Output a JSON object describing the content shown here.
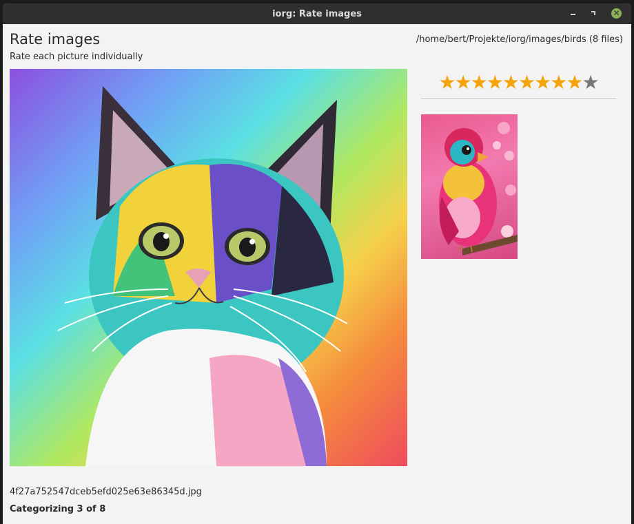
{
  "window": {
    "title": "iorg: Rate images",
    "controls": [
      "minimize-icon",
      "maximize-icon",
      "close-icon"
    ]
  },
  "header": {
    "heading": "Rate images",
    "subtitle": "Rate each picture individually",
    "path": "/home/bert/Projekte/iorg/images/birds (8 files)"
  },
  "rating": {
    "value": 9,
    "max": 10,
    "filled_color": "#f4a30b",
    "empty_color": "#777777"
  },
  "images": {
    "main_description_name": "kitten-image",
    "thumb_description_name": "bird-thumbnail"
  },
  "footer": {
    "filename": "4f27a752547dceb5efd025e63e86345d.jpg",
    "status": "Categorizing 3 of 8"
  }
}
